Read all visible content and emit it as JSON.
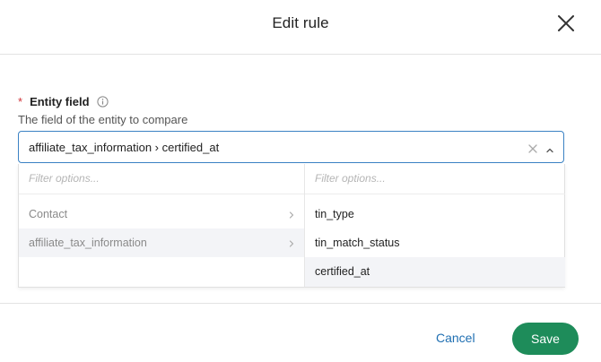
{
  "dialog": {
    "title": "Edit rule"
  },
  "field": {
    "required_mark": "*",
    "label": "Entity field",
    "description": "The field of the entity to compare",
    "selected_value": "affiliate_tax_information › certified_at"
  },
  "dropdown": {
    "left": {
      "filter_placeholder": "Filter options...",
      "options": [
        {
          "label": "Contact",
          "highlighted": false
        },
        {
          "label": "affiliate_tax_information",
          "highlighted": true
        }
      ]
    },
    "right": {
      "filter_placeholder": "Filter options...",
      "options": [
        {
          "label": "tin_type",
          "highlighted": false
        },
        {
          "label": "tin_match_status",
          "highlighted": false
        },
        {
          "label": "certified_at",
          "highlighted": true
        }
      ]
    }
  },
  "footer": {
    "cancel_label": "Cancel",
    "save_label": "Save"
  },
  "colors": {
    "accent_blue": "#1f6fb2",
    "focus_border": "#3b82c4",
    "save_green": "#1e8c5a",
    "required_red": "#d0343a",
    "highlight_row": "#f3f4f7"
  },
  "icons": {
    "close": "close-icon",
    "info": "info-icon",
    "clear": "clear-icon",
    "collapse": "chevron-up-icon",
    "submenu": "chevron-right-icon"
  }
}
